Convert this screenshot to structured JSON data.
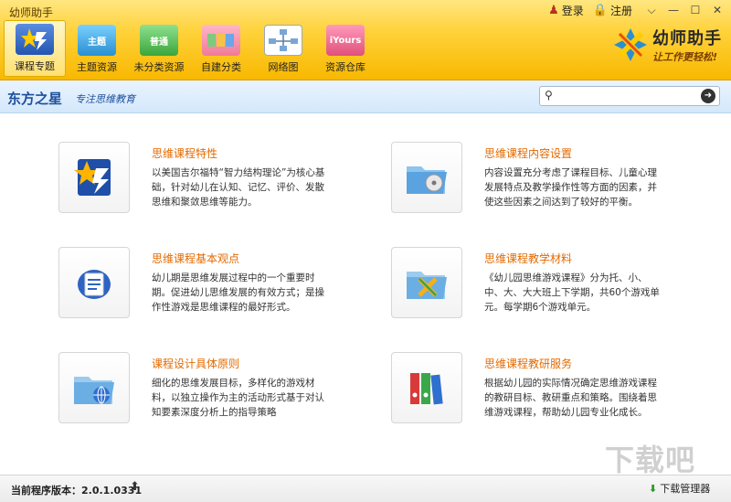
{
  "window": {
    "title": "幼师助手",
    "login_label": "登录",
    "register_label": "注册"
  },
  "toolbar": [
    {
      "label": "课程专题",
      "icon": "star-course-icon",
      "active": true
    },
    {
      "label": "主题资源",
      "icon": "theme-folder-icon",
      "badge": "主题"
    },
    {
      "label": "未分类资源",
      "icon": "uncategorized-folder-icon",
      "badge": "普通"
    },
    {
      "label": "自建分类",
      "icon": "custom-category-icon"
    },
    {
      "label": "网络图",
      "icon": "network-diagram-icon"
    },
    {
      "label": "资源仓库",
      "icon": "resource-bag-icon",
      "badge": "iYours"
    }
  ],
  "brand": {
    "name": "幼师助手",
    "slogan": "让工作更轻松!"
  },
  "banner": {
    "logo": "东方之星",
    "slogan": "专注思维教育"
  },
  "search": {
    "placeholder": ""
  },
  "cards": [
    {
      "title": "思维课程特性",
      "desc": "以美国吉尔福特“智力结构理论”为核心基础，针对幼儿在认知、记忆、评价、发散思维和聚敛思维等能力。",
      "icon": "star-course-icon"
    },
    {
      "title": "思维课程内容设置",
      "desc": "内容设置充分考虑了课程目标、儿童心理发展特点及教学操作性等方面的因素，并使这些因素之间达到了较好的平衡。",
      "icon": "folder-disc-icon"
    },
    {
      "title": "思维课程基本观点",
      "desc": "幼儿期是思维发展过程中的一个重要时期。促进幼儿思维发展的有效方式；是操作性游戏是思维课程的最好形式。",
      "icon": "document-chat-icon"
    },
    {
      "title": "思维课程教学材料",
      "desc": "《幼儿园思维游戏课程》分为托、小、中、大、大大班上下学期，共60个游戏单元。每学期6个游戏单元。",
      "icon": "folder-x-icon"
    },
    {
      "title": "课程设计具体原则",
      "desc": "细化的思维发展目标，多样化的游戏材料，以独立操作为主的活动形式基于对认知要素深度分析上的指导策略",
      "icon": "folder-globe-icon"
    },
    {
      "title": "思维课程教研服务",
      "desc": "根据幼儿园的实际情况确定思维游戏课程的教研目标、教研重点和策略。围绕着思维游戏课程，帮助幼儿园专业化成长。",
      "icon": "binders-icon"
    }
  ],
  "footer": {
    "version_label": "当前程序版本：2.0.1.0331",
    "download_manager": "下载管理器",
    "watermark": "下载吧"
  }
}
